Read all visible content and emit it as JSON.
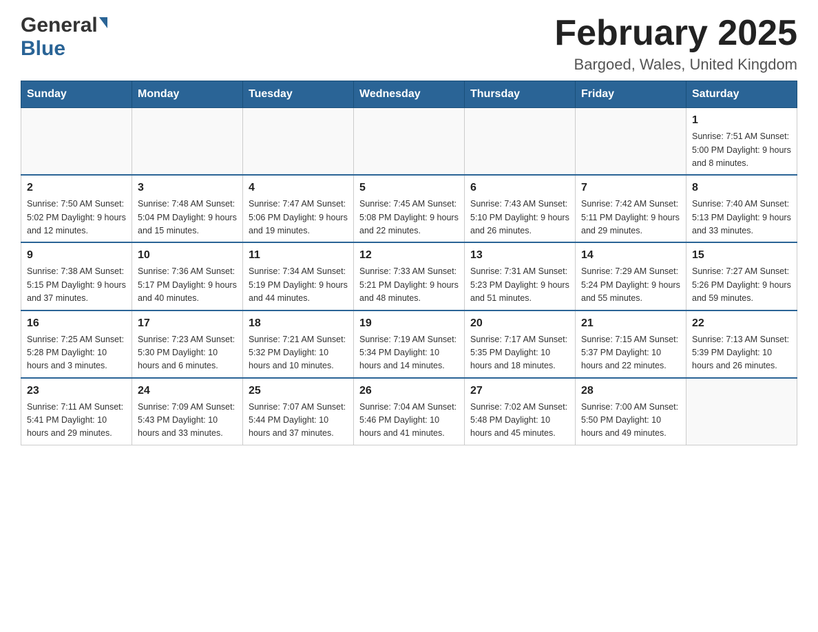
{
  "header": {
    "title": "February 2025",
    "location": "Bargoed, Wales, United Kingdom",
    "logo_general": "General",
    "logo_blue": "Blue"
  },
  "weekdays": [
    "Sunday",
    "Monday",
    "Tuesday",
    "Wednesday",
    "Thursday",
    "Friday",
    "Saturday"
  ],
  "weeks": [
    {
      "days": [
        {
          "number": "",
          "info": ""
        },
        {
          "number": "",
          "info": ""
        },
        {
          "number": "",
          "info": ""
        },
        {
          "number": "",
          "info": ""
        },
        {
          "number": "",
          "info": ""
        },
        {
          "number": "",
          "info": ""
        },
        {
          "number": "1",
          "info": "Sunrise: 7:51 AM\nSunset: 5:00 PM\nDaylight: 9 hours\nand 8 minutes."
        }
      ]
    },
    {
      "days": [
        {
          "number": "2",
          "info": "Sunrise: 7:50 AM\nSunset: 5:02 PM\nDaylight: 9 hours\nand 12 minutes."
        },
        {
          "number": "3",
          "info": "Sunrise: 7:48 AM\nSunset: 5:04 PM\nDaylight: 9 hours\nand 15 minutes."
        },
        {
          "number": "4",
          "info": "Sunrise: 7:47 AM\nSunset: 5:06 PM\nDaylight: 9 hours\nand 19 minutes."
        },
        {
          "number": "5",
          "info": "Sunrise: 7:45 AM\nSunset: 5:08 PM\nDaylight: 9 hours\nand 22 minutes."
        },
        {
          "number": "6",
          "info": "Sunrise: 7:43 AM\nSunset: 5:10 PM\nDaylight: 9 hours\nand 26 minutes."
        },
        {
          "number": "7",
          "info": "Sunrise: 7:42 AM\nSunset: 5:11 PM\nDaylight: 9 hours\nand 29 minutes."
        },
        {
          "number": "8",
          "info": "Sunrise: 7:40 AM\nSunset: 5:13 PM\nDaylight: 9 hours\nand 33 minutes."
        }
      ]
    },
    {
      "days": [
        {
          "number": "9",
          "info": "Sunrise: 7:38 AM\nSunset: 5:15 PM\nDaylight: 9 hours\nand 37 minutes."
        },
        {
          "number": "10",
          "info": "Sunrise: 7:36 AM\nSunset: 5:17 PM\nDaylight: 9 hours\nand 40 minutes."
        },
        {
          "number": "11",
          "info": "Sunrise: 7:34 AM\nSunset: 5:19 PM\nDaylight: 9 hours\nand 44 minutes."
        },
        {
          "number": "12",
          "info": "Sunrise: 7:33 AM\nSunset: 5:21 PM\nDaylight: 9 hours\nand 48 minutes."
        },
        {
          "number": "13",
          "info": "Sunrise: 7:31 AM\nSunset: 5:23 PM\nDaylight: 9 hours\nand 51 minutes."
        },
        {
          "number": "14",
          "info": "Sunrise: 7:29 AM\nSunset: 5:24 PM\nDaylight: 9 hours\nand 55 minutes."
        },
        {
          "number": "15",
          "info": "Sunrise: 7:27 AM\nSunset: 5:26 PM\nDaylight: 9 hours\nand 59 minutes."
        }
      ]
    },
    {
      "days": [
        {
          "number": "16",
          "info": "Sunrise: 7:25 AM\nSunset: 5:28 PM\nDaylight: 10 hours\nand 3 minutes."
        },
        {
          "number": "17",
          "info": "Sunrise: 7:23 AM\nSunset: 5:30 PM\nDaylight: 10 hours\nand 6 minutes."
        },
        {
          "number": "18",
          "info": "Sunrise: 7:21 AM\nSunset: 5:32 PM\nDaylight: 10 hours\nand 10 minutes."
        },
        {
          "number": "19",
          "info": "Sunrise: 7:19 AM\nSunset: 5:34 PM\nDaylight: 10 hours\nand 14 minutes."
        },
        {
          "number": "20",
          "info": "Sunrise: 7:17 AM\nSunset: 5:35 PM\nDaylight: 10 hours\nand 18 minutes."
        },
        {
          "number": "21",
          "info": "Sunrise: 7:15 AM\nSunset: 5:37 PM\nDaylight: 10 hours\nand 22 minutes."
        },
        {
          "number": "22",
          "info": "Sunrise: 7:13 AM\nSunset: 5:39 PM\nDaylight: 10 hours\nand 26 minutes."
        }
      ]
    },
    {
      "days": [
        {
          "number": "23",
          "info": "Sunrise: 7:11 AM\nSunset: 5:41 PM\nDaylight: 10 hours\nand 29 minutes."
        },
        {
          "number": "24",
          "info": "Sunrise: 7:09 AM\nSunset: 5:43 PM\nDaylight: 10 hours\nand 33 minutes."
        },
        {
          "number": "25",
          "info": "Sunrise: 7:07 AM\nSunset: 5:44 PM\nDaylight: 10 hours\nand 37 minutes."
        },
        {
          "number": "26",
          "info": "Sunrise: 7:04 AM\nSunset: 5:46 PM\nDaylight: 10 hours\nand 41 minutes."
        },
        {
          "number": "27",
          "info": "Sunrise: 7:02 AM\nSunset: 5:48 PM\nDaylight: 10 hours\nand 45 minutes."
        },
        {
          "number": "28",
          "info": "Sunrise: 7:00 AM\nSunset: 5:50 PM\nDaylight: 10 hours\nand 49 minutes."
        },
        {
          "number": "",
          "info": ""
        }
      ]
    }
  ]
}
